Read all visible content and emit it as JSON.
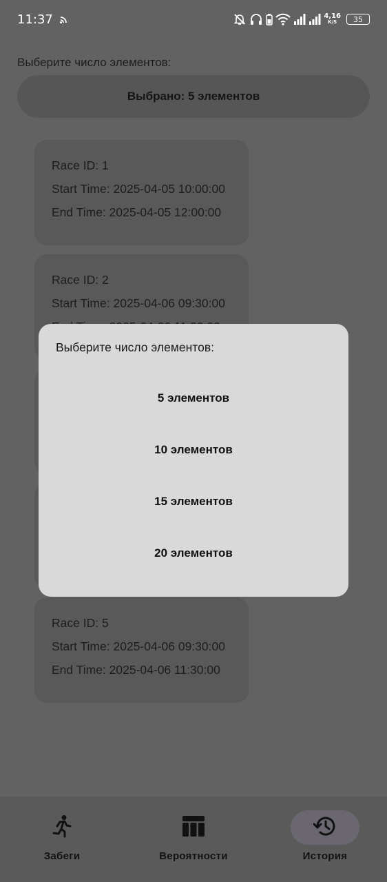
{
  "status_bar": {
    "time": "11:37",
    "net_speed_value": "4,16",
    "net_speed_unit": "K/S",
    "battery": "35",
    "icons": [
      "cast-icon",
      "mute-bell-icon",
      "headphones-icon",
      "battery-saver-icon",
      "wifi-icon",
      "signal-icon",
      "signal-icon-2"
    ]
  },
  "main": {
    "prompt_label": "Выберите число элементов:",
    "selected_button_label": "Выбрано: 5 элементов",
    "race_cards": [
      {
        "id_line": "Race ID: 1",
        "start_line": "Start Time: 2025-04-05 10:00:00",
        "end_line": "End Time: 2025-04-05 12:00:00"
      },
      {
        "id_line": "Race ID: 2",
        "start_line": "Start Time: 2025-04-06 09:30:00",
        "end_line": "End Time: 2025-04-06 11:30:00"
      },
      {
        "id_line": "",
        "start_line": "",
        "end_line": ""
      },
      {
        "id_line": "",
        "start_line": "",
        "end_line": ""
      },
      {
        "id_line": "Race ID: 5",
        "start_line": "Start Time: 2025-04-06 09:30:00",
        "end_line": "End Time: 2025-04-06 11:30:00"
      }
    ]
  },
  "dialog": {
    "title": "Выберите число элементов:",
    "options": [
      "5 элементов",
      "10 элементов",
      "15 элементов",
      "20 элементов"
    ]
  },
  "bottom_nav": {
    "items": [
      {
        "label": "Забеги",
        "icon": "running-icon",
        "active": false
      },
      {
        "label": "Вероятности",
        "icon": "table-icon",
        "active": false
      },
      {
        "label": "История",
        "icon": "history-icon",
        "active": true
      }
    ]
  },
  "colors": {
    "scrim_background": "#626262",
    "dialog_background": "#d9d9d9",
    "active_nav_pill": "#6b6771"
  }
}
